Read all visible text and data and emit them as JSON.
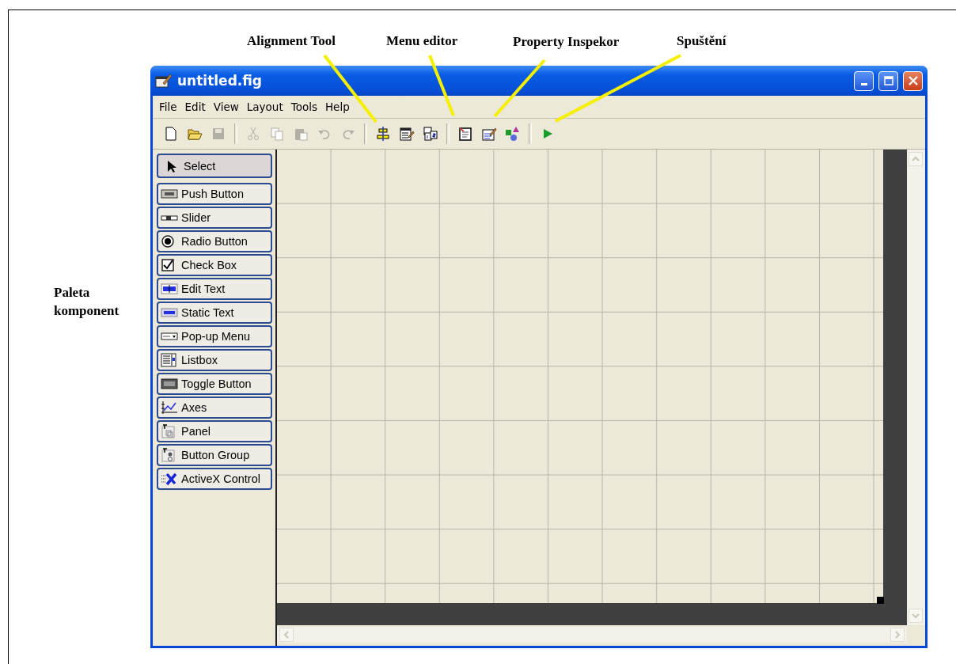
{
  "annotations": [
    {
      "label": "Alignment Tool"
    },
    {
      "label": "Menu editor"
    },
    {
      "label": "Property Inspekor"
    },
    {
      "label": "Spuštění"
    },
    {
      "label": "Paleta komponent"
    }
  ],
  "window": {
    "title": "untitled.fig"
  },
  "menu": [
    "File",
    "Edit",
    "View",
    "Layout",
    "Tools",
    "Help"
  ],
  "toolbar": [
    {
      "kind": "new",
      "disabled": false
    },
    {
      "kind": "open",
      "disabled": false
    },
    {
      "kind": "save",
      "disabled": true
    },
    {
      "kind": "separator"
    },
    {
      "kind": "cut",
      "disabled": true
    },
    {
      "kind": "copy",
      "disabled": true
    },
    {
      "kind": "paste",
      "disabled": true
    },
    {
      "kind": "undo",
      "disabled": true
    },
    {
      "kind": "redo",
      "disabled": true
    },
    {
      "kind": "separator"
    },
    {
      "kind": "align",
      "disabled": false
    },
    {
      "kind": "menu-editor",
      "disabled": false
    },
    {
      "kind": "tab-order",
      "disabled": false
    },
    {
      "kind": "separator"
    },
    {
      "kind": "editor",
      "disabled": false
    },
    {
      "kind": "inspector",
      "disabled": false
    },
    {
      "kind": "browser",
      "disabled": false
    },
    {
      "kind": "separator"
    },
    {
      "kind": "run",
      "disabled": false
    }
  ],
  "palette": [
    {
      "kind": "select",
      "label": "Select",
      "selected": true
    },
    {
      "kind": "push",
      "label": "Push Button",
      "selected": false
    },
    {
      "kind": "slider",
      "label": "Slider",
      "selected": false
    },
    {
      "kind": "radio",
      "label": "Radio Button",
      "selected": false
    },
    {
      "kind": "check",
      "label": "Check Box",
      "selected": false
    },
    {
      "kind": "edit",
      "label": "Edit Text",
      "selected": false
    },
    {
      "kind": "static",
      "label": "Static Text",
      "selected": false
    },
    {
      "kind": "popup",
      "label": "Pop-up Menu",
      "selected": false
    },
    {
      "kind": "listbox",
      "label": "Listbox",
      "selected": false
    },
    {
      "kind": "toggle",
      "label": "Toggle Button",
      "selected": false
    },
    {
      "kind": "axes",
      "label": "Axes",
      "selected": false
    },
    {
      "kind": "panel",
      "label": "Panel",
      "selected": false
    },
    {
      "kind": "group",
      "label": "Button Group",
      "selected": false
    },
    {
      "kind": "activex",
      "label": "ActiveX Control",
      "selected": false
    }
  ]
}
